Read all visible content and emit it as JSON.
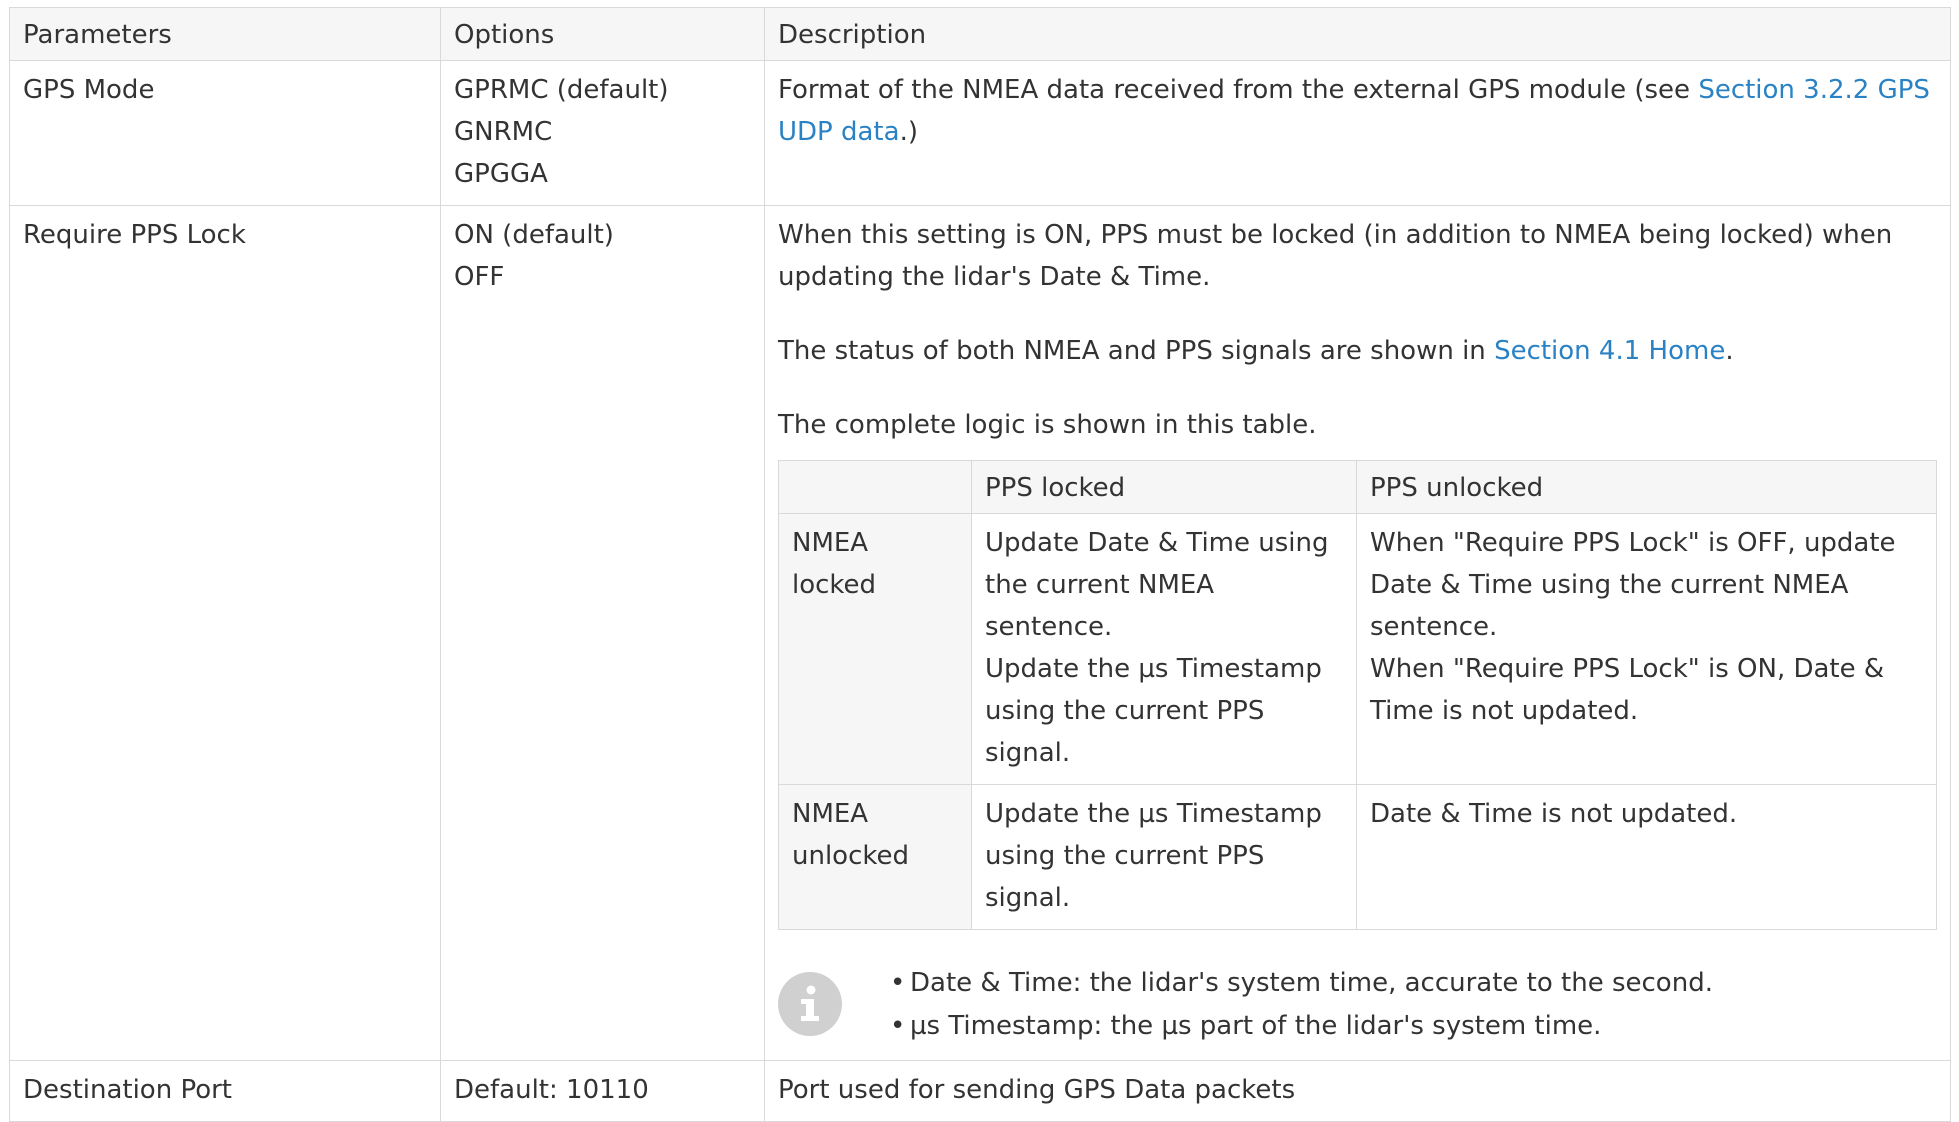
{
  "table": {
    "headers": [
      "Parameters",
      "Options",
      "Description"
    ],
    "rows": {
      "gps_mode": {
        "param": "GPS Mode",
        "options": [
          "GPRMC (default)",
          "GNRMC",
          "GPGGA"
        ],
        "desc_before": "Format of the NMEA data received from the external GPS module (see ",
        "desc_link": "Section 3.2.2 GPS UDP data",
        "desc_after": ".)"
      },
      "require_pps": {
        "param": "Require PPS Lock",
        "options": [
          "ON (default)",
          "OFF"
        ],
        "p1": "When this setting is ON, PPS must be locked (in addition to NMEA being locked) when updating the lidar's Date & Time.",
        "p2_before": "The status of both NMEA and PPS signals are shown in ",
        "p2_link": "Section 4.1 Home",
        "p2_after": ".",
        "p3": "The complete logic is shown in this table.",
        "logic_table": {
          "headers": [
            "",
            "PPS locked",
            "PPS unlocked"
          ],
          "rows": [
            {
              "head": "NMEA locked",
              "locked": "Update Date & Time using the current NMEA sentence.",
              "locked_2": "Update the µs Timestamp using the current PPS signal.",
              "unlocked": "When \"Require PPS Lock\" is OFF, update Date & Time using the current NMEA sentence.",
              "unlocked_2": "When \"Require PPS Lock\" is ON, Date & Time is not updated."
            },
            {
              "head": "NMEA unlocked",
              "locked": "Update the µs Timestamp using the current PPS signal.",
              "unlocked": "Date & Time is not updated."
            }
          ]
        },
        "note": {
          "icon": "info-icon",
          "bullet": "•",
          "items": [
            "Date & Time: the lidar's system time, accurate to the second.",
            "µs Timestamp: the µs part of the lidar's system time."
          ]
        }
      },
      "dest_port": {
        "param": "Destination Port",
        "options": [
          "Default: 10110"
        ],
        "desc": "Port used for sending GPS Data packets"
      }
    }
  },
  "colors": {
    "link": "#2a82c4",
    "border": "#d9d9d9",
    "header_bg": "#f6f6f6",
    "icon_bg": "#d0d0d0"
  }
}
